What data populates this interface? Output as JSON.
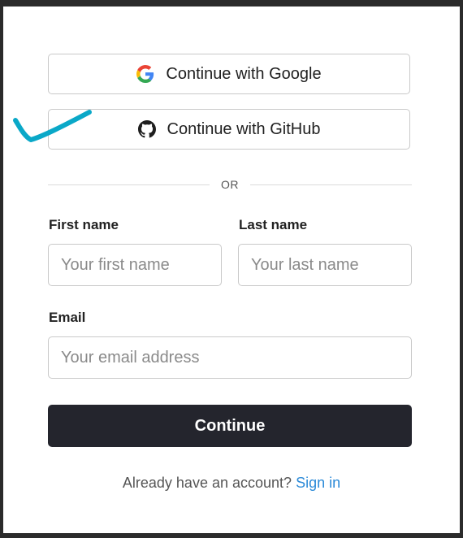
{
  "oauth": {
    "google": {
      "label": "Continue with Google",
      "icon": "google-icon"
    },
    "github": {
      "label": "Continue with GitHub",
      "icon": "github-icon"
    }
  },
  "divider": {
    "text": "OR"
  },
  "form": {
    "first_name": {
      "label": "First name",
      "placeholder": "Your first name",
      "value": ""
    },
    "last_name": {
      "label": "Last name",
      "placeholder": "Your last name",
      "value": ""
    },
    "email": {
      "label": "Email",
      "placeholder": "Your email address",
      "value": ""
    },
    "submit_label": "Continue"
  },
  "footer": {
    "prompt": "Already have an account?",
    "link_label": "Sign in"
  },
  "annotation": {
    "mark": "checkmark",
    "color": "#0aa8c8"
  },
  "colors": {
    "primary_button_bg": "#24252d",
    "link": "#2b8ad8",
    "border": "#c9c9c9"
  }
}
